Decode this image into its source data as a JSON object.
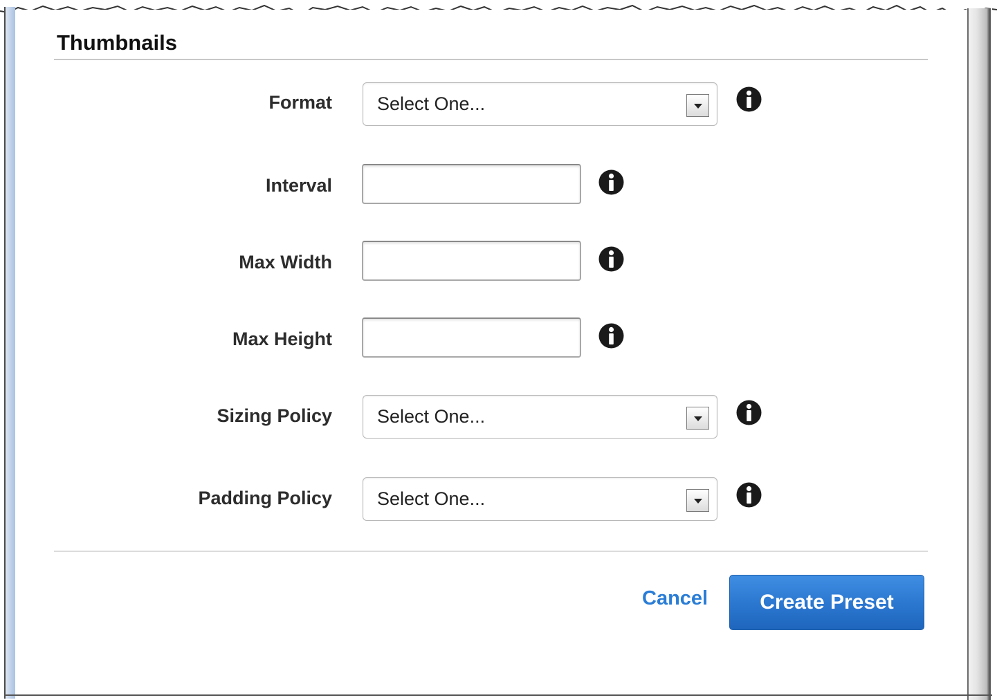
{
  "section": {
    "title": "Thumbnails"
  },
  "fields": [
    {
      "label": "Format",
      "type": "select",
      "value": "Select One..."
    },
    {
      "label": "Interval",
      "type": "text",
      "value": ""
    },
    {
      "label": "Max Width",
      "type": "text",
      "value": ""
    },
    {
      "label": "Max Height",
      "type": "text",
      "value": ""
    },
    {
      "label": "Sizing Policy",
      "type": "select",
      "value": "Select One..."
    },
    {
      "label": "Padding Policy",
      "type": "select",
      "value": "Select One..."
    }
  ],
  "actions": {
    "cancel_label": "Cancel",
    "create_label": "Create Preset"
  },
  "icons": {
    "info": "info-icon",
    "dropdown": "chevron-down-icon"
  },
  "colors": {
    "link": "#2a7dd6",
    "primary_button": "#2a76cf",
    "info_icon": "#1a1a1a"
  }
}
